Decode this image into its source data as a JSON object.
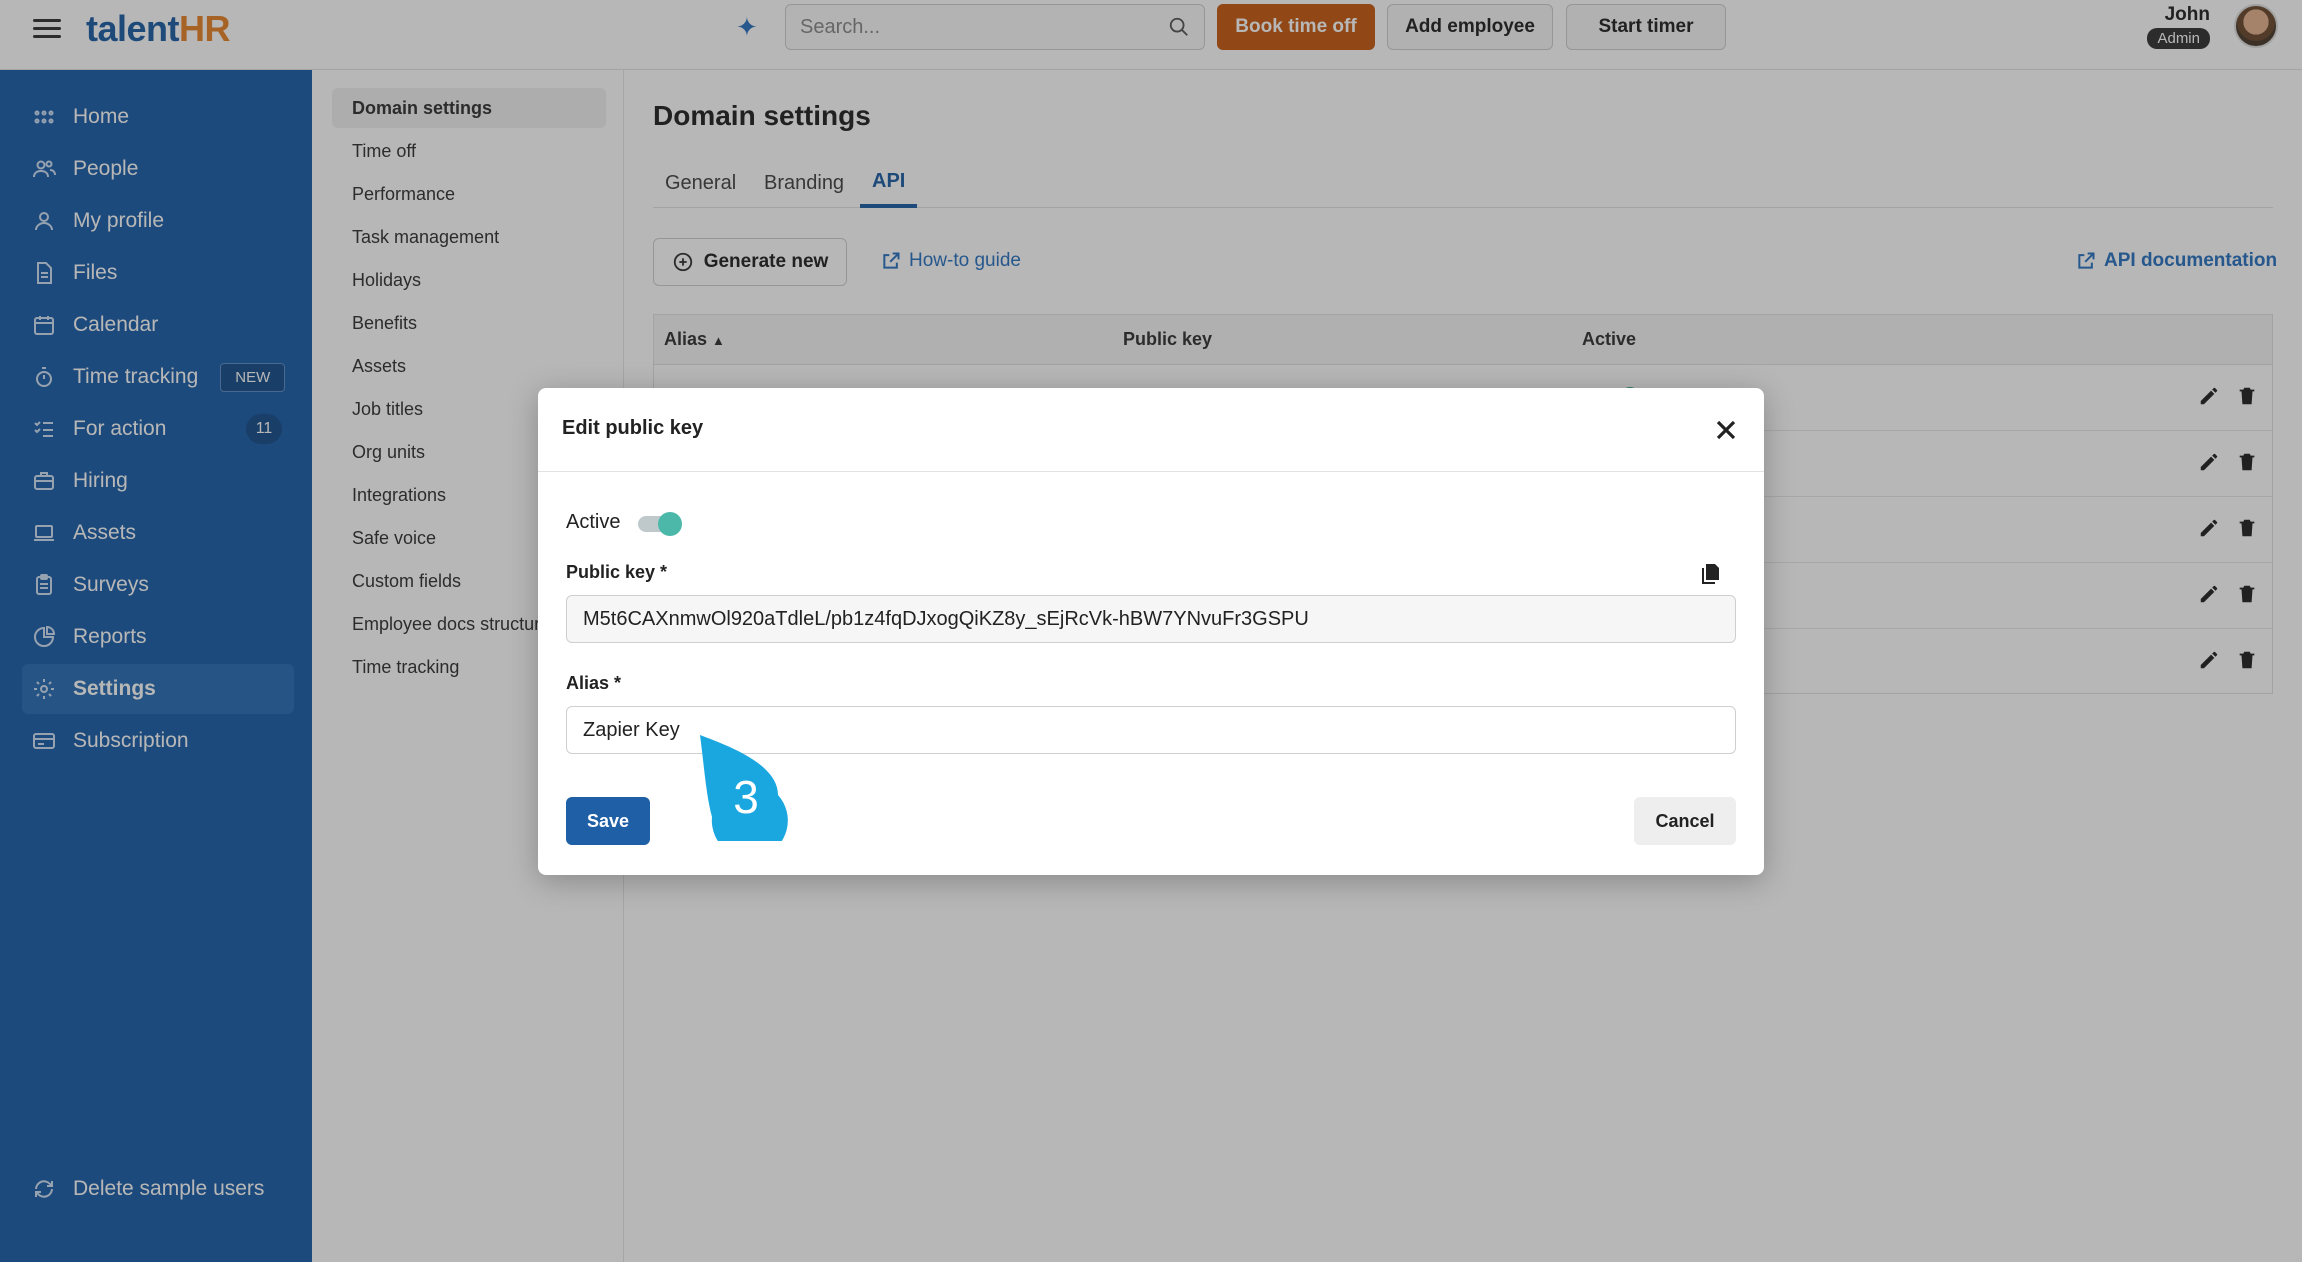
{
  "topbar": {
    "logo_main": "talent",
    "logo_accent": "HR",
    "search_placeholder": "Search...",
    "book_time_off": "Book time off",
    "add_employee": "Add employee",
    "start_timer": "Start timer",
    "user_name": "John",
    "user_role": "Admin"
  },
  "sidebar": {
    "items": [
      {
        "label": "Home",
        "icon": "home-grid-icon"
      },
      {
        "label": "People",
        "icon": "people-icon"
      },
      {
        "label": "My profile",
        "icon": "profile-icon"
      },
      {
        "label": "Files",
        "icon": "file-icon"
      },
      {
        "label": "Calendar",
        "icon": "calendar-icon"
      },
      {
        "label": "Time tracking",
        "icon": "stopwatch-icon",
        "badge": "NEW"
      },
      {
        "label": "For action",
        "icon": "checklist-icon",
        "count": "11"
      },
      {
        "label": "Hiring",
        "icon": "briefcase-icon"
      },
      {
        "label": "Assets",
        "icon": "laptop-icon"
      },
      {
        "label": "Surveys",
        "icon": "clipboard-icon"
      },
      {
        "label": "Reports",
        "icon": "pie-chart-icon"
      },
      {
        "label": "Settings",
        "icon": "gear-icon"
      },
      {
        "label": "Subscription",
        "icon": "card-icon"
      }
    ],
    "footer": "Delete sample users"
  },
  "submenu": {
    "items": [
      "Domain settings",
      "Time off",
      "Performance",
      "Task management",
      "Holidays",
      "Benefits",
      "Assets",
      "Job titles",
      "Org units",
      "Integrations",
      "Safe voice",
      "Custom fields",
      "Employee docs structure",
      "Time tracking"
    ]
  },
  "main": {
    "title": "Domain settings",
    "tabs": [
      "General",
      "Branding",
      "API"
    ],
    "generate_new": "Generate new",
    "howto": "How-to guide",
    "api_docs": "API documentation",
    "columns": {
      "alias": "Alias",
      "public_key": "Public key",
      "active": "Active"
    }
  },
  "modal": {
    "title": "Edit public key",
    "active_label": "Active",
    "active_value": true,
    "public_key_label": "Public key *",
    "public_key_value": "M5t6CAXnmwOl920aTdleL/pb1z4fqDJxogQiKZ8y_sEjRcVk-hBW7YNvuFr3GSPU",
    "alias_label": "Alias *",
    "alias_value": "Zapier Key",
    "save": "Save",
    "cancel": "Cancel"
  },
  "step_marker": "3",
  "colors": {
    "sidebar": "#1d5fa8",
    "accent": "#1e5fa6",
    "book": "#c95a12",
    "toggle": "#4bb8aa",
    "marker": "#1aa7e0"
  }
}
